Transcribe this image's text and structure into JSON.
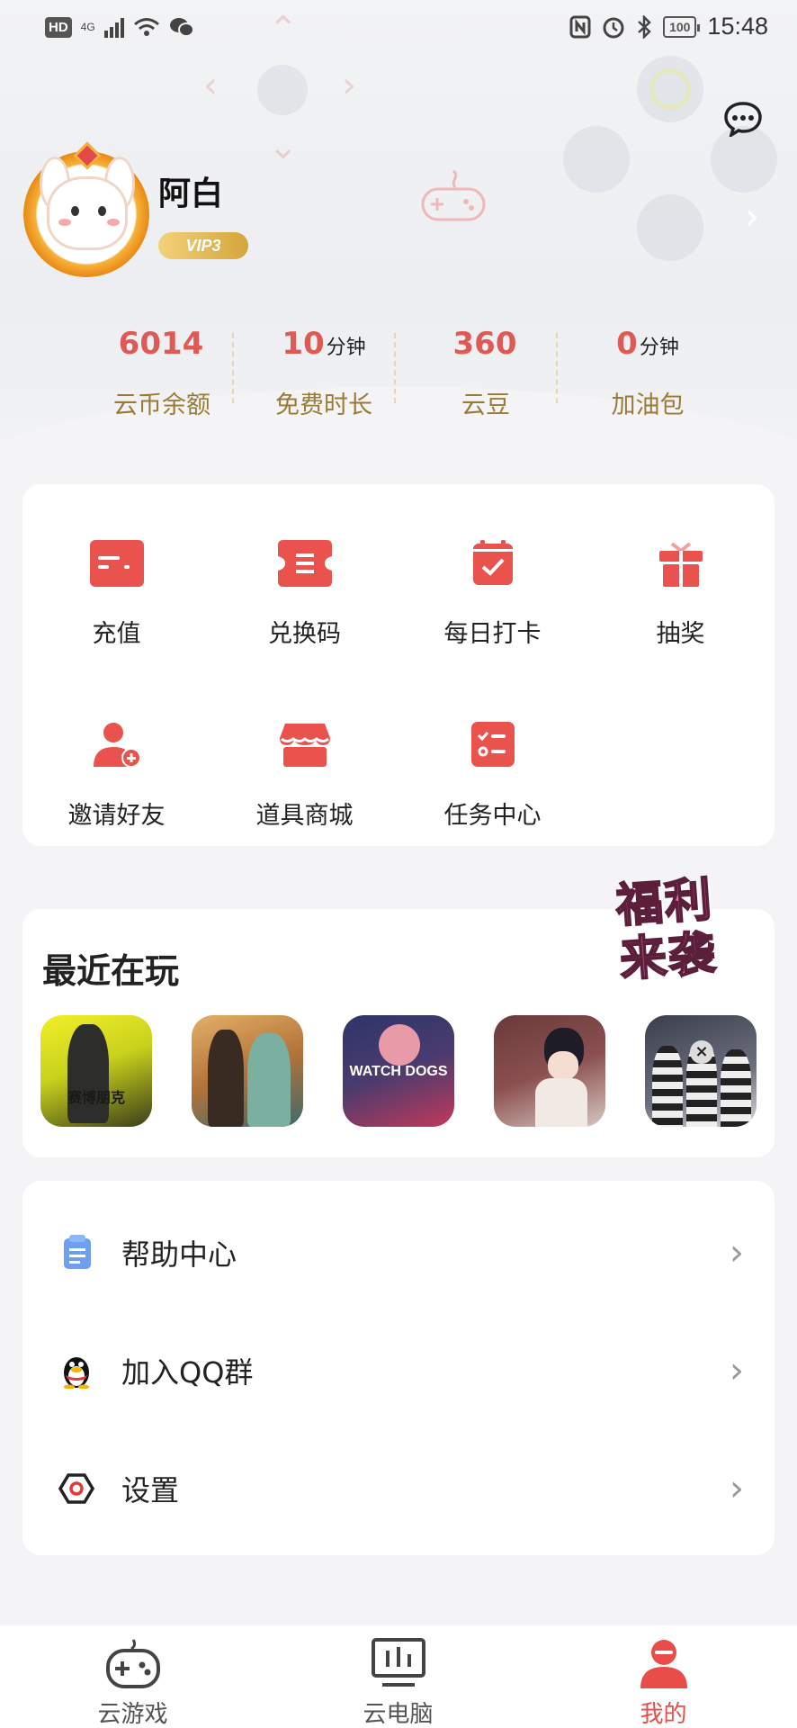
{
  "status_bar": {
    "left_badge": "HD",
    "network": "4G",
    "time": "15:48",
    "battery": "100"
  },
  "profile": {
    "username": "阿白",
    "vip_label": "VIP3"
  },
  "stats": [
    {
      "value": "6014",
      "unit": "",
      "label": "云币余额"
    },
    {
      "value": "10",
      "unit": "分钟",
      "label": "免费时长"
    },
    {
      "value": "360",
      "unit": "",
      "label": "云豆"
    },
    {
      "value": "0",
      "unit": "分钟",
      "label": "加油包"
    }
  ],
  "quick_actions": [
    {
      "label": "充值",
      "icon": "card-icon"
    },
    {
      "label": "兑换码",
      "icon": "ticket-icon"
    },
    {
      "label": "每日打卡",
      "icon": "calendar-check-icon"
    },
    {
      "label": "抽奖",
      "icon": "gift-icon"
    },
    {
      "label": "邀请好友",
      "icon": "add-user-icon"
    },
    {
      "label": "道具商城",
      "icon": "shop-icon"
    },
    {
      "label": "任务中心",
      "icon": "task-list-icon"
    }
  ],
  "recent": {
    "title": "最近在玩",
    "promo_line1": "福利",
    "promo_line2": "来袭",
    "games": [
      {
        "label": "赛博朋克",
        "color": "#d8e21a"
      },
      {
        "label": "",
        "color": "#c98a3a"
      },
      {
        "label": "WATCH DOGS",
        "color": "#3b3f66"
      },
      {
        "label": "",
        "color": "#7a4a4a"
      },
      {
        "label": "",
        "color": "#2c2f3a"
      }
    ]
  },
  "menu": [
    {
      "label": "帮助中心",
      "icon": "document-icon"
    },
    {
      "label": "加入QQ群",
      "icon": "qq-penguin-icon"
    },
    {
      "label": "设置",
      "icon": "hexagon-settings-icon"
    }
  ],
  "bottom_nav": [
    {
      "label": "云游戏",
      "icon": "gamepad-icon",
      "active": false
    },
    {
      "label": "云电脑",
      "icon": "monitor-icon",
      "active": false
    },
    {
      "label": "我的",
      "icon": "user-icon",
      "active": true
    }
  ],
  "colors": {
    "accent": "#e84d4a",
    "stat_value": "#e05a55",
    "stat_label": "#9b7a35"
  }
}
